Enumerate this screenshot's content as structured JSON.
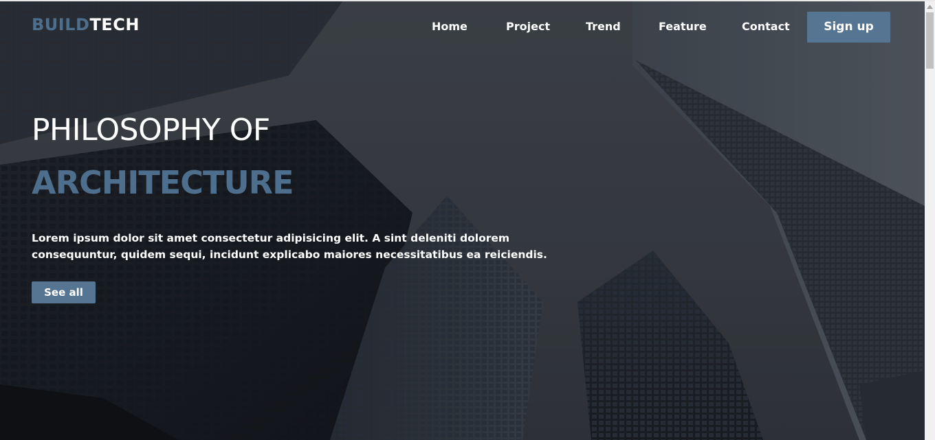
{
  "logo": {
    "part1": "BUILD",
    "part2": "TECH"
  },
  "nav": {
    "items": [
      {
        "label": "Home"
      },
      {
        "label": "Project"
      },
      {
        "label": "Trend"
      },
      {
        "label": "Feature"
      },
      {
        "label": "Contact"
      }
    ],
    "signup_label": "Sign up"
  },
  "hero": {
    "title_line1": "PHILOSOPHY OF",
    "title_line2": "ARCHITECTURE",
    "description": "Lorem ipsum dolor sit amet consectetur adipisicing elit. A sint deleniti dolorem consequuntur, quidem sequi, incidunt explicabo maiores necessitatibus ea reiciendis.",
    "button_label": "See all"
  },
  "colors": {
    "accent": "#557593",
    "accent_text": "#4d6e8c",
    "text": "#ffffff"
  },
  "icons": {
    "scroll_up": "chevron-up-icon"
  }
}
